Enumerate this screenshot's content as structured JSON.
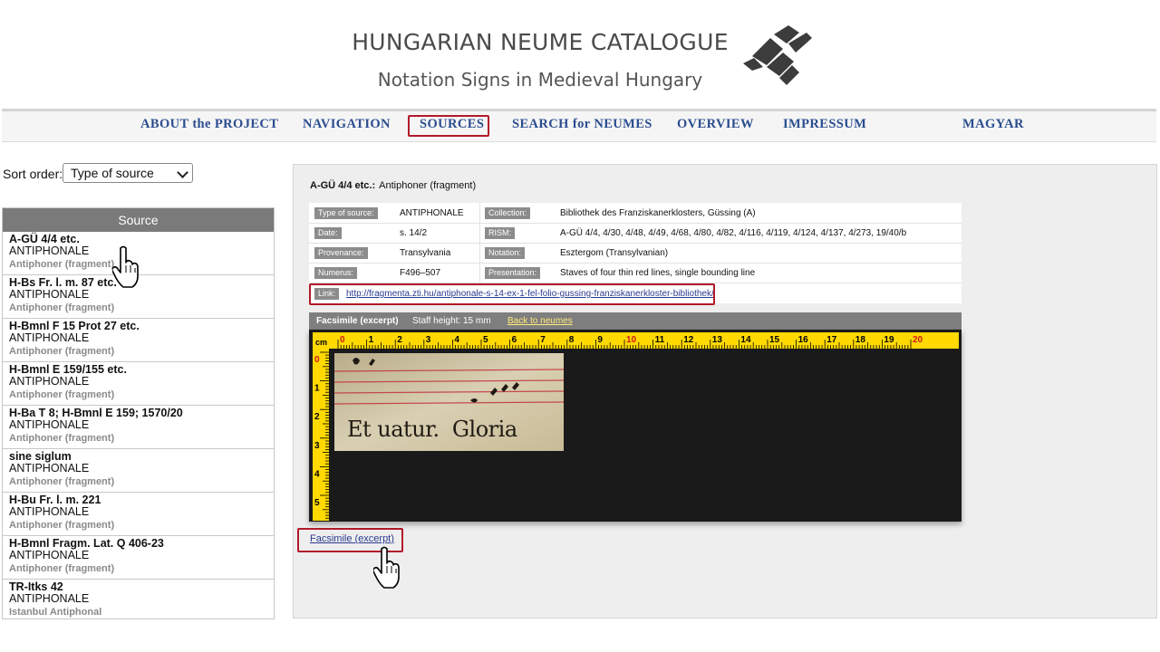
{
  "header": {
    "title": "HUNGARIAN NEUME CATALOGUE",
    "subtitle": "Notation Signs in Medieval Hungary"
  },
  "nav": {
    "items": [
      {
        "label": "ABOUT the PROJECT"
      },
      {
        "label": "NAVIGATION"
      },
      {
        "label": "SOURCES"
      },
      {
        "label": "SEARCH for NEUMES"
      },
      {
        "label": "OVERVIEW"
      },
      {
        "label": "IMPRESSUM"
      },
      {
        "label": "MAGYAR"
      }
    ],
    "active": "SOURCES"
  },
  "sort": {
    "label": "Sort order:",
    "value": "Type of source"
  },
  "sources": {
    "header": "Source",
    "items": [
      {
        "siglum": "A-GÜ 4/4 etc.",
        "type": "ANTIPHONALE",
        "desc": "Antiphoner (fragment)"
      },
      {
        "siglum": "H-Bs Fr. l. m. 87 etc.",
        "type": "ANTIPHONALE",
        "desc": "Antiphoner (fragment)"
      },
      {
        "siglum": "H-Bmnl F 15 Prot 27 etc.",
        "type": "ANTIPHONALE",
        "desc": "Antiphoner (fragment)"
      },
      {
        "siglum": "H-Bmnl E 159/155 etc.",
        "type": "ANTIPHONALE",
        "desc": "Antiphoner (fragment)"
      },
      {
        "siglum": "H-Ba T 8; H-Bmnl E 159; 1570/20",
        "type": "ANTIPHONALE",
        "desc": "Antiphoner (fragment)"
      },
      {
        "siglum": "sine siglum",
        "type": "ANTIPHONALE",
        "desc": "Antiphoner (fragment)"
      },
      {
        "siglum": "H-Bu Fr. l. m. 221",
        "type": "ANTIPHONALE",
        "desc": "Antiphoner (fragment)"
      },
      {
        "siglum": "H-Bmnl Fragm. Lat. Q 406-23",
        "type": "ANTIPHONALE",
        "desc": "Antiphoner (fragment)"
      },
      {
        "siglum": "TR-Itks 42",
        "type": "ANTIPHONALE",
        "desc": "Istanbul Antiphonal"
      }
    ]
  },
  "detail": {
    "siglum": "A-GÜ 4/4 etc.:",
    "title": "Antiphoner (fragment)",
    "rows": [
      {
        "k1": "Type of source:",
        "v1": "ANTIPHONALE",
        "k2": "Collection:",
        "v2": "Bibliothek des Franziskanerklosters, Güssing (A)"
      },
      {
        "k1": "Date:",
        "v1": "s. 14/2",
        "k2": "RISM:",
        "v2": "A-GÜ 4/4, 4/30, 4/48, 4/49, 4/68, 4/80, 4/82, 4/116, 4/119, 4/124, 4/137, 4/273, 19/40/b"
      },
      {
        "k1": "Provenance:",
        "v1": "Transylvania",
        "k2": "Notation:",
        "v2": "Esztergom (Transylvanian)"
      },
      {
        "k1": "Numerus:",
        "v1": "F496–507",
        "k2": "Presentation:",
        "v2": "Staves of four thin red lines, single bounding line"
      }
    ],
    "link_label": "Link:",
    "link_url": "http://fragmenta.zti.hu/antiphonale-s-14-ex-1-fel-folio-gussing-franziskanerkloster-bibliothek/"
  },
  "facsimile": {
    "title": "Facsimile (excerpt)",
    "staff_height": "Staff height: 15 mm",
    "back_link": "Back to neumes",
    "ruler_unit": "cm",
    "ruler_top": [
      "0",
      "1",
      "2",
      "3",
      "4",
      "5",
      "6",
      "7",
      "8",
      "9",
      "10",
      "11",
      "12",
      "13",
      "14",
      "15",
      "16",
      "17",
      "18",
      "19",
      "20"
    ],
    "ruler_left": [
      "0",
      "1",
      "2",
      "3",
      "4",
      "5"
    ],
    "image_text": "Et uatur.  Gloria",
    "link": "Facsimile (excerpt)"
  },
  "colors": {
    "nav_text": "#2a4d8f",
    "highlight": "#b11a2a",
    "ruler": "#ffd900",
    "ruler_marks": "#d21a1a"
  }
}
